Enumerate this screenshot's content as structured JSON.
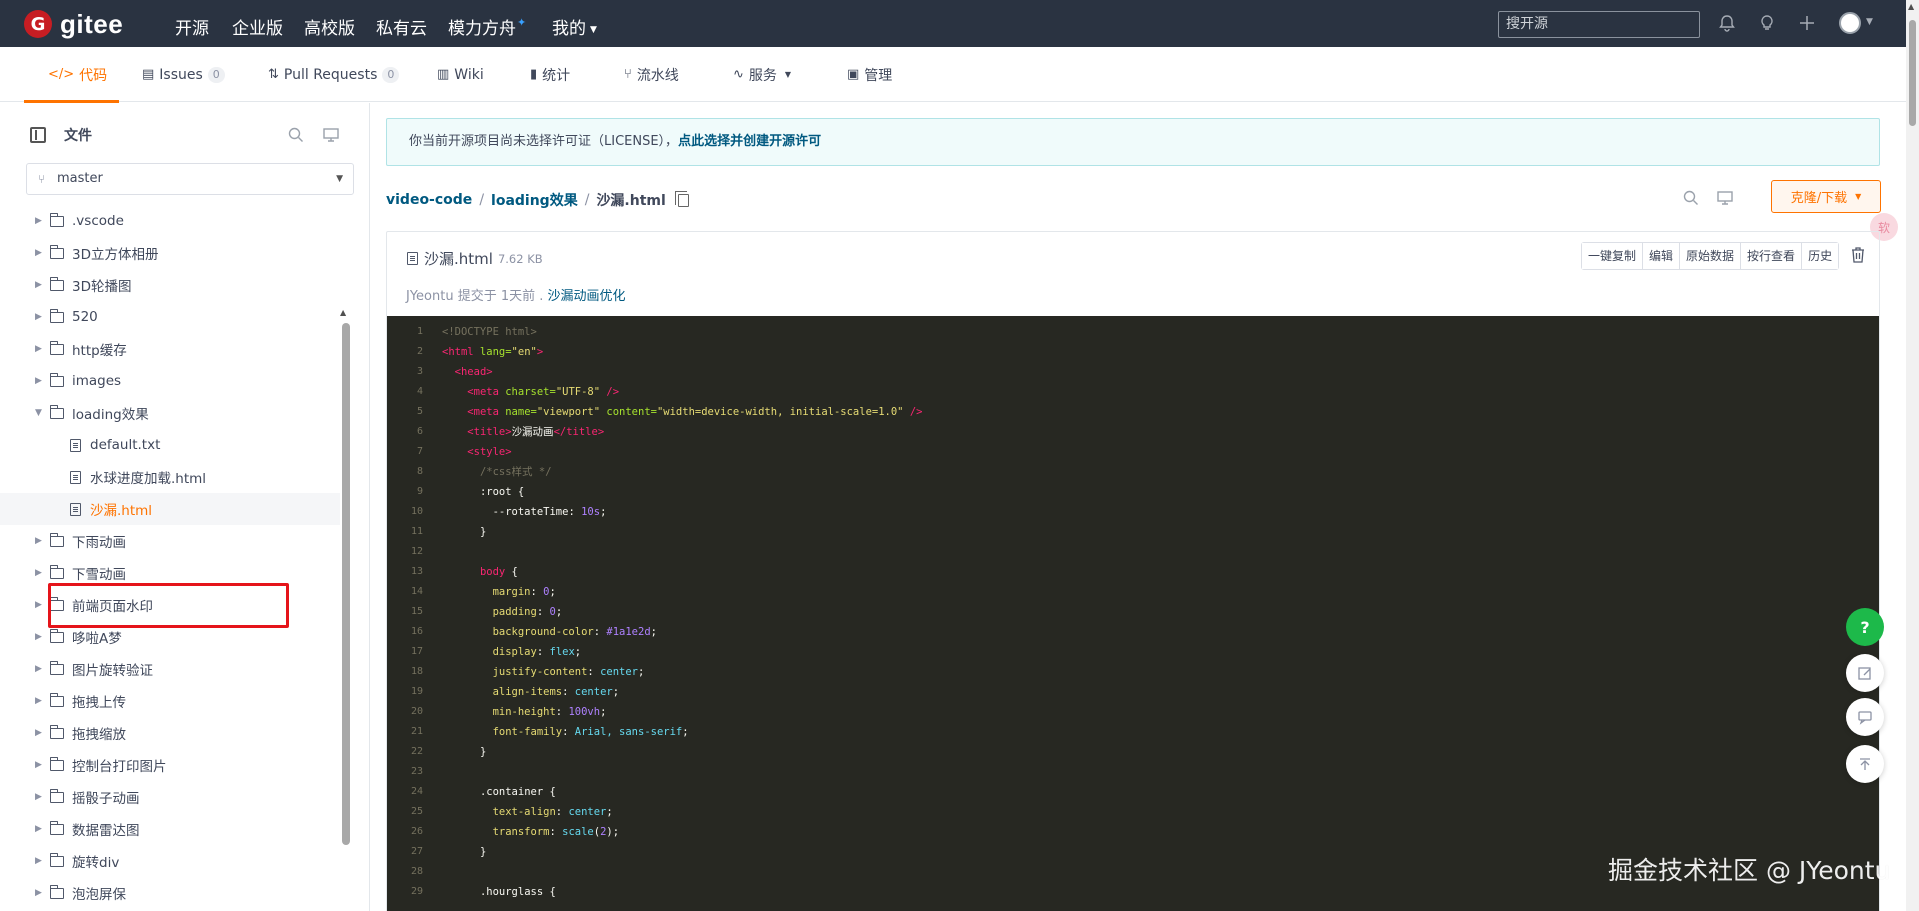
{
  "topnav": {
    "logo_g": "G",
    "logo_text": "gitee",
    "items": [
      "开源",
      "企业版",
      "高校版",
      "私有云",
      "模力方舟"
    ],
    "mine": "我的",
    "search_placeholder": "搜开源"
  },
  "tabs": [
    {
      "label": "代码",
      "icon": "code-icon"
    },
    {
      "label": "Issues",
      "badge": "0",
      "icon": "issues-icon"
    },
    {
      "label": "Pull Requests",
      "badge": "0",
      "icon": "pull-request-icon"
    },
    {
      "label": "Wiki",
      "icon": "wiki-icon"
    },
    {
      "label": "统计",
      "icon": "stats-icon"
    },
    {
      "label": "流水线",
      "icon": "pipeline-icon"
    },
    {
      "label": "服务",
      "icon": "service-icon"
    },
    {
      "label": "管理",
      "icon": "manage-icon"
    }
  ],
  "left": {
    "title": "文件",
    "branch": "master",
    "tree": [
      {
        "label": ".vscode",
        "type": "folder"
      },
      {
        "label": "3D立方体相册",
        "type": "folder"
      },
      {
        "label": "3D轮播图",
        "type": "folder"
      },
      {
        "label": "520",
        "type": "folder"
      },
      {
        "label": "http缓存",
        "type": "folder"
      },
      {
        "label": "images",
        "type": "folder"
      },
      {
        "label": "loading效果",
        "type": "folder",
        "open": true
      },
      {
        "label": "default.txt",
        "type": "file"
      },
      {
        "label": "水球进度加载.html",
        "type": "file"
      },
      {
        "label": "沙漏.html",
        "type": "file",
        "selected": true
      },
      {
        "label": "下雨动画",
        "type": "folder"
      },
      {
        "label": "下雪动画",
        "type": "folder"
      },
      {
        "label": "前端页面水印",
        "type": "folder"
      },
      {
        "label": "哆啦A梦",
        "type": "folder"
      },
      {
        "label": "图片旋转验证",
        "type": "folder"
      },
      {
        "label": "拖拽上传",
        "type": "folder"
      },
      {
        "label": "拖拽缩放",
        "type": "folder"
      },
      {
        "label": "控制台打印图片",
        "type": "folder"
      },
      {
        "label": "摇骰子动画",
        "type": "folder"
      },
      {
        "label": "数据雷达图",
        "type": "folder"
      },
      {
        "label": "旋转div",
        "type": "folder"
      },
      {
        "label": "泡泡屏保",
        "type": "folder"
      }
    ]
  },
  "notice": {
    "text": "你当前开源项目尚未选择许可证（LICENSE），",
    "link": "点此选择并创建开源许可"
  },
  "breadcrumb": {
    "repo": "video-code",
    "folder": "loading效果",
    "file": "沙漏.html"
  },
  "clone_button": "克隆/下载",
  "float_pink": "软",
  "file": {
    "name": "沙漏.html",
    "size": "7.62 KB",
    "buttons": [
      "一键复制",
      "编辑",
      "原始数据",
      "按行查看",
      "历史"
    ],
    "commit_author": "JYeontu",
    "commit_mid": "提交于 1天前 .",
    "commit_msg": "沙漏动画优化"
  },
  "code_lines": [
    "1",
    "2",
    "3",
    "4",
    "5",
    "6",
    "7",
    "8",
    "9",
    "10",
    "11",
    "12",
    "13",
    "14",
    "15",
    "16",
    "17",
    "18",
    "19",
    "20",
    "21",
    "22",
    "23",
    "24",
    "25",
    "26",
    "27",
    "28",
    "29"
  ],
  "code_text": {
    "l1": "<!DOCTYPE html>",
    "l2_tag": "<html",
    "l2_attr": " lang=",
    "l2_str": "\"en\"",
    "l2_end": ">",
    "l3": "<head>",
    "l4_tag": "<meta",
    "l4_attr": " charset=",
    "l4_str": "\"UTF-8\"",
    "l4_end": " />",
    "l5_tag": "<meta",
    "l5_attr1": " name=",
    "l5_str1": "\"viewport\"",
    "l5_attr2": " content=",
    "l5_str2": "\"width=device-width, initial-scale=1.0\"",
    "l5_end": " />",
    "l6_open": "<title>",
    "l6_text": "沙漏动画",
    "l6_close": "</title>",
    "l7": "<style>",
    "l8": "/*css样式 */",
    "l9": ":root {",
    "l10_prop": "--rotateTime",
    "l10_val": "10s",
    "l11": "}",
    "l13_sel": "body",
    "l13_rest": " {",
    "l14_prop": "margin",
    "l14_val": "0",
    "l15_prop": "padding",
    "l15_val": "0",
    "l16_prop": "background-color",
    "l16_val": "#1a1e2d",
    "l17_prop": "display",
    "l17_val": "flex",
    "l18_prop": "justify-content",
    "l18_val": "center",
    "l19_prop": "align-items",
    "l19_val": "center",
    "l20_prop": "min-height",
    "l20_val": "100vh",
    "l21_prop": "font-family",
    "l21_val": "Arial, sans-serif",
    "l22": "}",
    "l24": ".container {",
    "l25_prop": "text-align",
    "l25_val": "center",
    "l26_prop": "transform",
    "l26_fn": "scale",
    "l26_num": "2",
    "l27": "}",
    "l29": ".hourglass {"
  },
  "fabs": [
    "help-icon",
    "edit-icon",
    "comment-icon",
    "back-to-top-icon"
  ],
  "fab_help": "?",
  "watermark": "掘金技术社区 @ JYeontu"
}
